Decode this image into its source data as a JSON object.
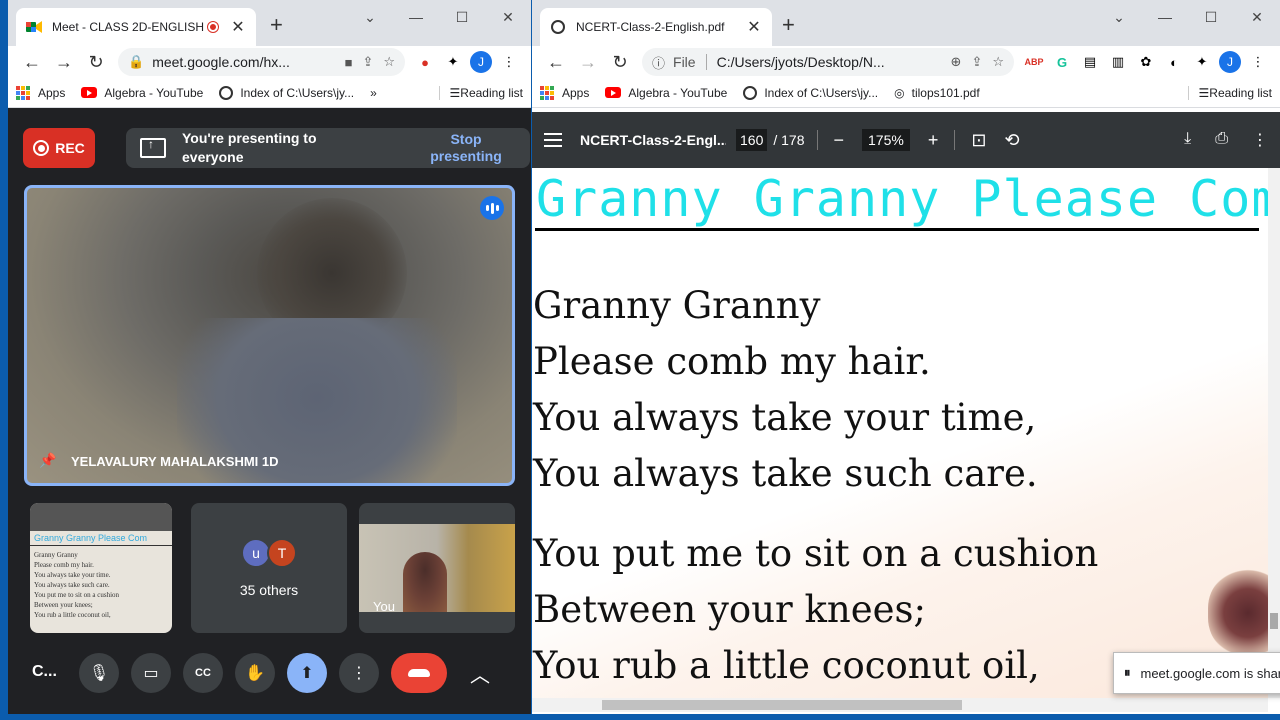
{
  "left_browser": {
    "tab_title": "Meet - CLASS 2D-ENGLISH",
    "url": "meet.google.com/hx...",
    "bookmarks": [
      "Apps",
      "Algebra - YouTube",
      "Index of C:\\Users\\jy..."
    ],
    "overflow": "»",
    "reading_list": "Reading list",
    "profile_initial": "J"
  },
  "meet": {
    "rec_label": "REC",
    "presenting_text": "You're presenting to everyone",
    "stop_label": "Stop presenting",
    "main_participant": "YELAVALURY MAHALAKSHMI 1D",
    "others_avatars": [
      {
        "letter": "u",
        "color": "#5e6dbf"
      },
      {
        "letter": "T",
        "color": "#c5441f"
      }
    ],
    "others_count": "35 others",
    "self_label": "You",
    "meeting_code": "C...",
    "share_thumb_title": "Granny Granny Please Com",
    "share_thumb_lines": [
      "Granny Granny",
      "Please comb my hair.",
      "You always take your time.",
      "You always take such care.",
      "You put me to sit on a cushion",
      "Between your knees;",
      "You rub a little coconut oil,"
    ]
  },
  "right_browser": {
    "tab_title": "NCERT-Class-2-English.pdf",
    "url_prefix": "File",
    "url": "C:/Users/jyots/Desktop/N...",
    "bookmarks": [
      "Apps",
      "Algebra - YouTube",
      "Index of C:\\Users\\jy...",
      "tilops101.pdf"
    ],
    "reading_list": "Reading list",
    "profile_initial": "J"
  },
  "pdf": {
    "filename": "NCERT-Class-2-Engl...",
    "current_page": "160",
    "total_pages": "/ 178",
    "zoom": "175%",
    "heading": "Granny Granny Please Com",
    "lines": [
      "Granny Granny",
      "Please comb my hair.",
      "You always take your time,",
      "You always take such care.",
      "You put me to sit on a cushion",
      "Between your knees;",
      "You rub a little coconut oil,"
    ]
  },
  "share_notice": "meet.google.com is sharing",
  "colors": {
    "accent_blue": "#8ab4f8",
    "rec_red": "#d93025",
    "hangup_red": "#ea4335",
    "heading_cyan": "#1fe0e8",
    "meet_bg": "#202124"
  }
}
